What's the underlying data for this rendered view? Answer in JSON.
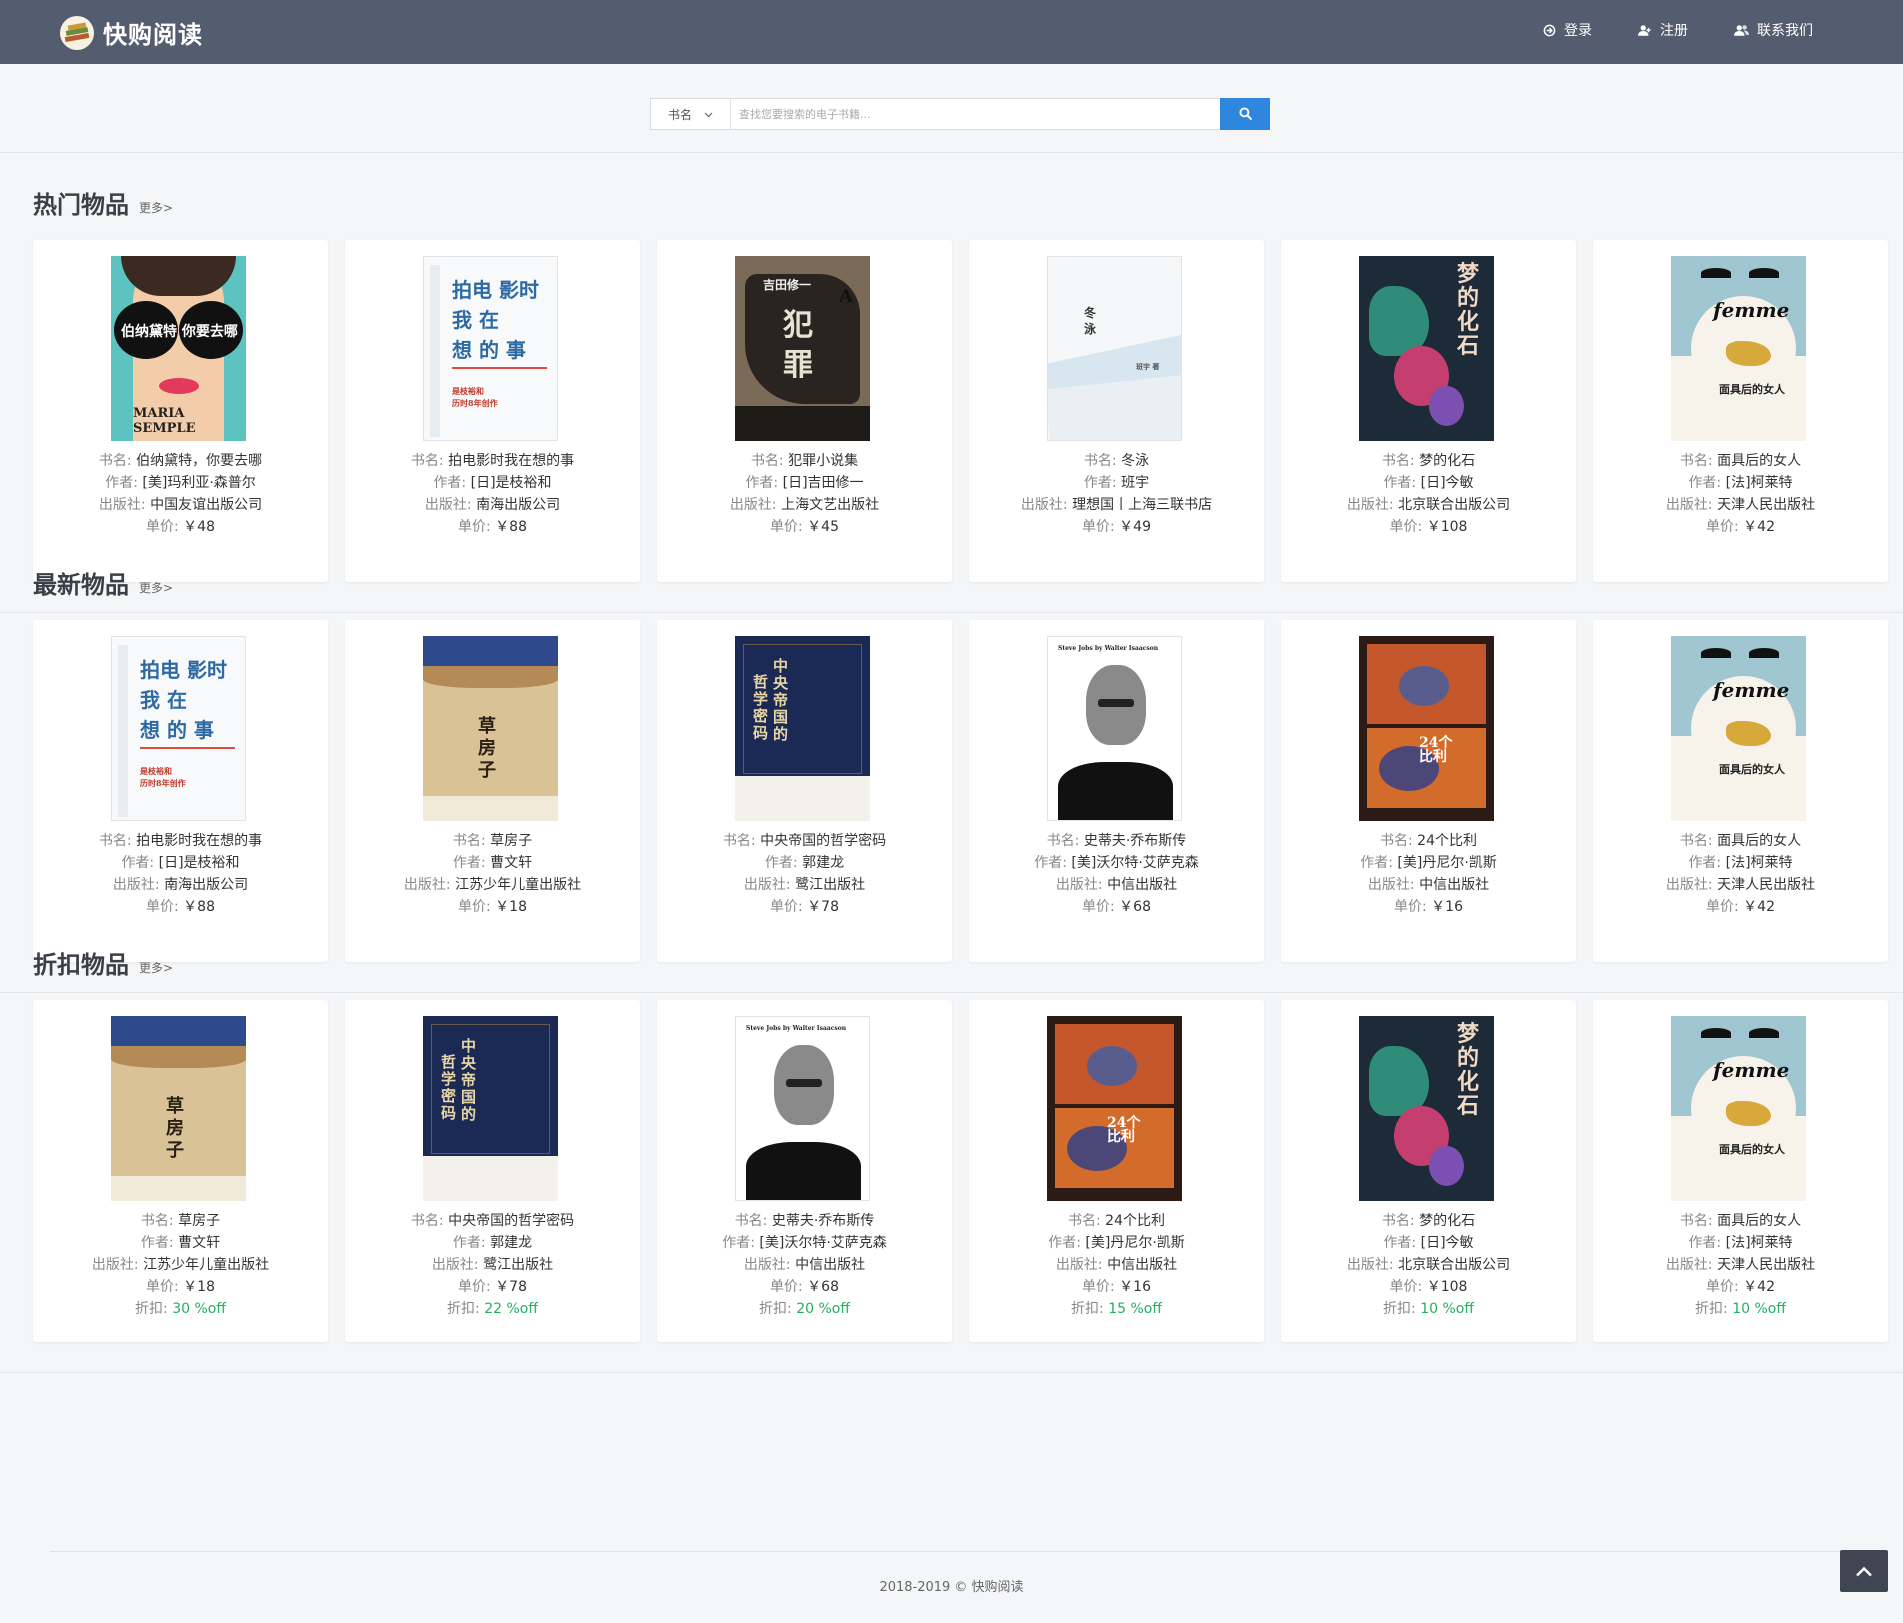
{
  "brand": {
    "name": "快购阅读"
  },
  "nav": {
    "login": "登录",
    "register": "注册",
    "contact": "联系我们"
  },
  "search": {
    "type_label": "书名",
    "placeholder": "查找您要搜索的电子书籍..."
  },
  "labels": {
    "title": "书名: ",
    "author": "作者: ",
    "publisher": "出版社: ",
    "price": "单价: ",
    "discount": "折扣: "
  },
  "sections": [
    {
      "title": "热门物品",
      "more": "更多>",
      "books": [
        {
          "title": "伯纳黛特，你要去哪",
          "author": "[美]玛利亚·森普尔",
          "publisher": "中国友谊出版公司",
          "price": "￥48",
          "cover": "sunglasses"
        },
        {
          "title": "拍电影时我在想的事",
          "author": "[日]是枝裕和",
          "publisher": "南海出版公司",
          "price": "￥88",
          "cover": "kore"
        },
        {
          "title": "犯罪小说集",
          "author": "[日]吉田修一",
          "publisher": "上海文艺出版社",
          "price": "￥45",
          "cover": "crime"
        },
        {
          "title": "冬泳",
          "author": "班宇",
          "publisher": "理想国丨上海三联书店",
          "price": "￥49",
          "cover": "winter"
        },
        {
          "title": "梦的化石",
          "author": "[日]今敏",
          "publisher": "北京联合出版公司",
          "price": "￥108",
          "cover": "fossil"
        },
        {
          "title": "面具后的女人",
          "author": "[法]柯莱特",
          "publisher": "天津人民出版社",
          "price": "￥42",
          "cover": "femme"
        }
      ]
    },
    {
      "title": "最新物品",
      "more": "更多>",
      "books": [
        {
          "title": "拍电影时我在想的事",
          "author": "[日]是枝裕和",
          "publisher": "南海出版公司",
          "price": "￥88",
          "cover": "kore"
        },
        {
          "title": "草房子",
          "author": "曹文轩",
          "publisher": "江苏少年儿童出版社",
          "price": "￥18",
          "cover": "grass"
        },
        {
          "title": "中央帝国的哲学密码",
          "author": "郭建龙",
          "publisher": "鹭江出版社",
          "price": "￥78",
          "cover": "empire"
        },
        {
          "title": "史蒂夫·乔布斯传",
          "author": "[美]沃尔特·艾萨克森",
          "publisher": "中信出版社",
          "price": "￥68",
          "cover": "jobs"
        },
        {
          "title": "24个比利",
          "author": "[美]丹尼尔·凯斯",
          "publisher": "中信出版社",
          "price": "￥16",
          "cover": "billy"
        },
        {
          "title": "面具后的女人",
          "author": "[法]柯莱特",
          "publisher": "天津人民出版社",
          "price": "￥42",
          "cover": "femme"
        }
      ]
    },
    {
      "title": "折扣物品",
      "more": "更多>",
      "books": [
        {
          "title": "草房子",
          "author": "曹文轩",
          "publisher": "江苏少年儿童出版社",
          "price": "￥18",
          "discount": "30 %off",
          "cover": "grass"
        },
        {
          "title": "中央帝国的哲学密码",
          "author": "郭建龙",
          "publisher": "鹭江出版社",
          "price": "￥78",
          "discount": "22 %off",
          "cover": "empire"
        },
        {
          "title": "史蒂夫·乔布斯传",
          "author": "[美]沃尔特·艾萨克森",
          "publisher": "中信出版社",
          "price": "￥68",
          "discount": "20 %off",
          "cover": "jobs"
        },
        {
          "title": "24个比利",
          "author": "[美]丹尼尔·凯斯",
          "publisher": "中信出版社",
          "price": "￥16",
          "discount": "15 %off",
          "cover": "billy"
        },
        {
          "title": "梦的化石",
          "author": "[日]今敏",
          "publisher": "北京联合出版公司",
          "price": "￥108",
          "discount": "10 %off",
          "cover": "fossil"
        },
        {
          "title": "面具后的女人",
          "author": "[法]柯莱特",
          "publisher": "天津人民出版社",
          "price": "￥42",
          "discount": "10 %off",
          "cover": "femme"
        }
      ]
    }
  ],
  "footer": {
    "text": "2018-2019 © 快购阅读"
  }
}
